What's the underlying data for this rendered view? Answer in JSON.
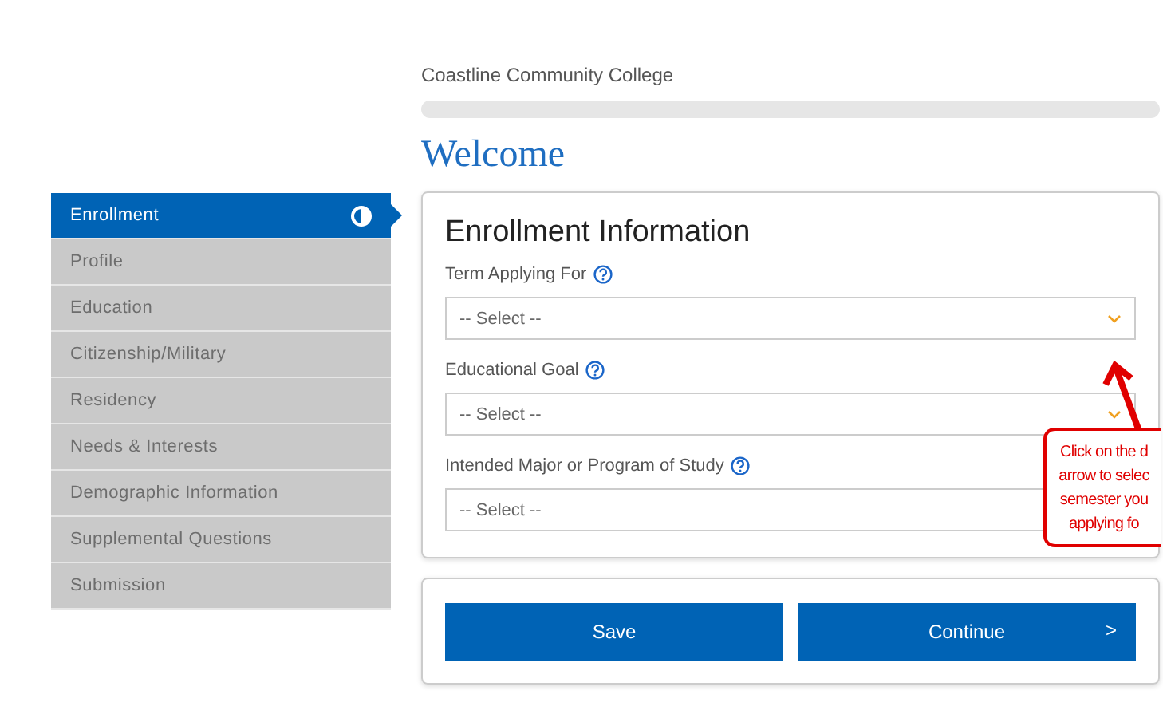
{
  "header": {
    "college": "Coastline Community College",
    "heading": "Welcome"
  },
  "sidebar": {
    "items": [
      {
        "label": "Enrollment",
        "selected": true
      },
      {
        "label": "Profile",
        "selected": false
      },
      {
        "label": "Education",
        "selected": false
      },
      {
        "label": "Citizenship/Military",
        "selected": false
      },
      {
        "label": "Residency",
        "selected": false
      },
      {
        "label": "Needs & Interests",
        "selected": false
      },
      {
        "label": "Demographic Information",
        "selected": false
      },
      {
        "label": "Supplemental Questions",
        "selected": false
      },
      {
        "label": "Submission",
        "selected": false
      }
    ]
  },
  "form": {
    "title": "Enrollment Information",
    "fields": [
      {
        "label": "Term Applying For",
        "placeholder": "-- Select --"
      },
      {
        "label": "Educational Goal",
        "placeholder": "-- Select --"
      },
      {
        "label": "Intended Major or Program of Study",
        "placeholder": "-- Select --"
      }
    ]
  },
  "buttons": [
    {
      "label": "Save",
      "kind": "plain"
    },
    {
      "label": "Continue",
      "kind": "next",
      "icon": ">"
    }
  ],
  "callout": {
    "lines": [
      "Click on the d",
      "arrow to selec",
      "semester you",
      "applying fo"
    ]
  }
}
